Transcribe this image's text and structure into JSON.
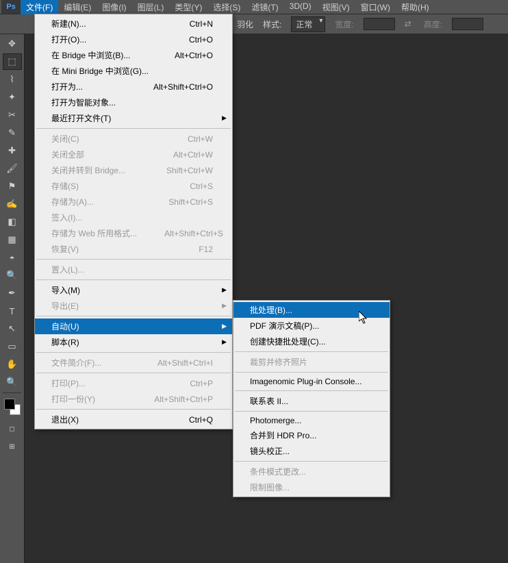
{
  "menubar": {
    "items": [
      "文件(F)",
      "编辑(E)",
      "图像(I)",
      "图层(L)",
      "类型(Y)",
      "选择(S)",
      "滤镜(T)",
      "3D(D)",
      "视图(V)",
      "窗口(W)",
      "帮助(H)"
    ]
  },
  "toolbar": {
    "feather_label": "羽化",
    "style_label": "样式:",
    "style_value": "正常",
    "width_label": "宽度:",
    "height_label": "高度:"
  },
  "file_menu": [
    {
      "label": "新建(N)...",
      "shortcut": "Ctrl+N"
    },
    {
      "label": "打开(O)...",
      "shortcut": "Ctrl+O"
    },
    {
      "label": "在 Bridge 中浏览(B)...",
      "shortcut": "Alt+Ctrl+O"
    },
    {
      "label": "在 Mini Bridge 中浏览(G)..."
    },
    {
      "label": "打开为...",
      "shortcut": "Alt+Shift+Ctrl+O"
    },
    {
      "label": "打开为智能对象..."
    },
    {
      "label": "最近打开文件(T)",
      "arrow": true
    },
    {
      "sep": true
    },
    {
      "label": "关闭(C)",
      "shortcut": "Ctrl+W",
      "disabled": true
    },
    {
      "label": "关闭全部",
      "shortcut": "Alt+Ctrl+W",
      "disabled": true
    },
    {
      "label": "关闭并转到 Bridge...",
      "shortcut": "Shift+Ctrl+W",
      "disabled": true
    },
    {
      "label": "存储(S)",
      "shortcut": "Ctrl+S",
      "disabled": true
    },
    {
      "label": "存储为(A)...",
      "shortcut": "Shift+Ctrl+S",
      "disabled": true
    },
    {
      "label": "签入(I)...",
      "disabled": true
    },
    {
      "label": "存储为 Web 所用格式...",
      "shortcut": "Alt+Shift+Ctrl+S",
      "disabled": true
    },
    {
      "label": "恢复(V)",
      "shortcut": "F12",
      "disabled": true
    },
    {
      "sep": true
    },
    {
      "label": "置入(L)...",
      "disabled": true
    },
    {
      "sep": true
    },
    {
      "label": "导入(M)",
      "arrow": true
    },
    {
      "label": "导出(E)",
      "arrow": true,
      "disabled": true
    },
    {
      "sep": true
    },
    {
      "label": "自动(U)",
      "arrow": true,
      "highlight": true
    },
    {
      "label": "脚本(R)",
      "arrow": true
    },
    {
      "sep": true
    },
    {
      "label": "文件简介(F)...",
      "shortcut": "Alt+Shift+Ctrl+I",
      "disabled": true
    },
    {
      "sep": true
    },
    {
      "label": "打印(P)...",
      "shortcut": "Ctrl+P",
      "disabled": true
    },
    {
      "label": "打印一份(Y)",
      "shortcut": "Alt+Shift+Ctrl+P",
      "disabled": true
    },
    {
      "sep": true
    },
    {
      "label": "退出(X)",
      "shortcut": "Ctrl+Q"
    }
  ],
  "auto_menu": [
    {
      "label": "批处理(B)...",
      "highlight": true
    },
    {
      "label": "PDF 演示文稿(P)..."
    },
    {
      "label": "创建快捷批处理(C)..."
    },
    {
      "sep": true
    },
    {
      "label": "裁剪并修齐照片",
      "disabled": true
    },
    {
      "sep": true
    },
    {
      "label": "Imagenomic Plug-in Console..."
    },
    {
      "sep": true
    },
    {
      "label": "联系表 II..."
    },
    {
      "sep": true
    },
    {
      "label": "Photomerge..."
    },
    {
      "label": "合并到 HDR Pro..."
    },
    {
      "label": "镜头校正..."
    },
    {
      "sep": true
    },
    {
      "label": "条件模式更改...",
      "disabled": true
    },
    {
      "label": "限制图像...",
      "disabled": true
    }
  ]
}
